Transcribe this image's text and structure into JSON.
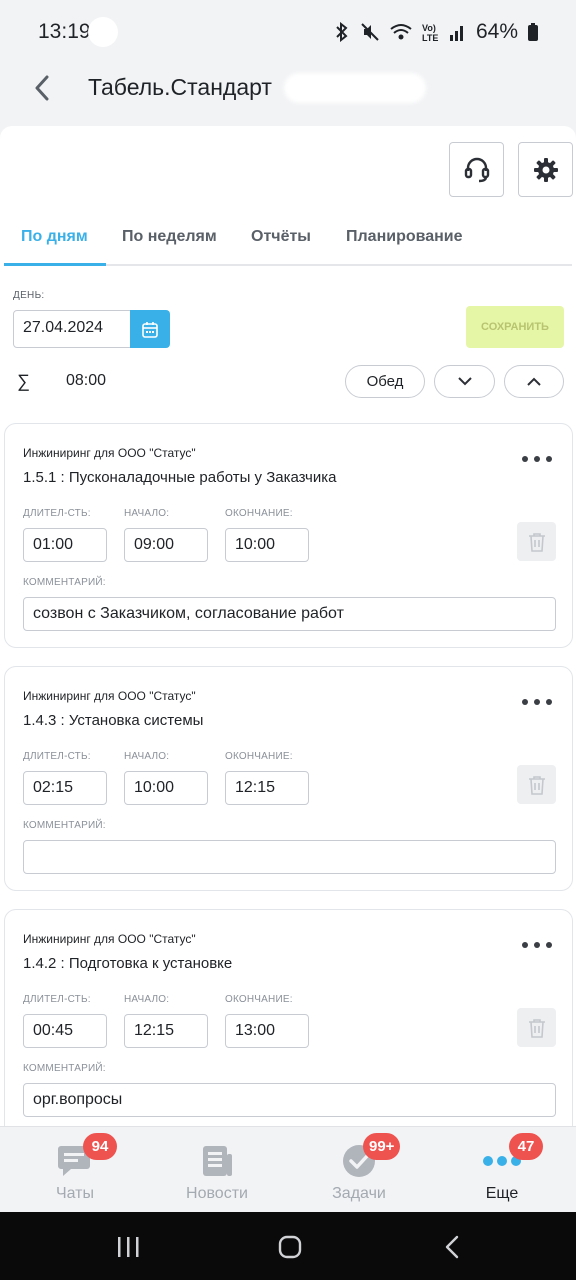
{
  "status_bar": {
    "time": "13:19",
    "battery": "64%"
  },
  "header": {
    "title": "Табель.Стандарт"
  },
  "tabs": [
    {
      "label": "По дням"
    },
    {
      "label": "По неделям"
    },
    {
      "label": "Отчёты"
    },
    {
      "label": "Планирование"
    }
  ],
  "day": {
    "label": "ДЕНЬ:",
    "date": "27.04.2024",
    "save_label": "СОХРАНИТЬ",
    "sum_symbol": "∑",
    "total": "08:00",
    "lunch_label": "Обед"
  },
  "field_labels": {
    "duration": "ДЛИТЕЛ-СТЬ:",
    "start": "НАЧАЛО:",
    "end": "ОКОНЧАНИЕ:",
    "comment": "КОММЕНТАРИЙ:"
  },
  "entries": [
    {
      "org": "Инжиниринг для ООО \"Статус\"",
      "task": "1.5.1 : Пусконаладочные работы у Заказчика",
      "duration": "01:00",
      "start": "09:00",
      "end": "10:00",
      "comment": "созвон с Заказчиком, согласование работ"
    },
    {
      "org": "Инжиниринг для ООО \"Статус\"",
      "task": "1.4.3 : Установка системы",
      "duration": "02:15",
      "start": "10:00",
      "end": "12:15",
      "comment": ""
    },
    {
      "org": "Инжиниринг для ООО \"Статус\"",
      "task": "1.4.2 : Подготовка к установке",
      "duration": "00:45",
      "start": "12:15",
      "end": "13:00",
      "comment": "орг.вопросы"
    }
  ],
  "bottom_nav": [
    {
      "label": "Чаты",
      "badge": "94",
      "icon": "chat-icon"
    },
    {
      "label": "Новости",
      "badge": "",
      "icon": "news-icon"
    },
    {
      "label": "Задачи",
      "badge": "99+",
      "icon": "tasks-icon"
    },
    {
      "label": "Еще",
      "badge": "47",
      "icon": "more-icon"
    }
  ],
  "colors": {
    "accent": "#3ab0e8",
    "save_disabled": "#e5f6a6",
    "badge": "#ef5350"
  }
}
